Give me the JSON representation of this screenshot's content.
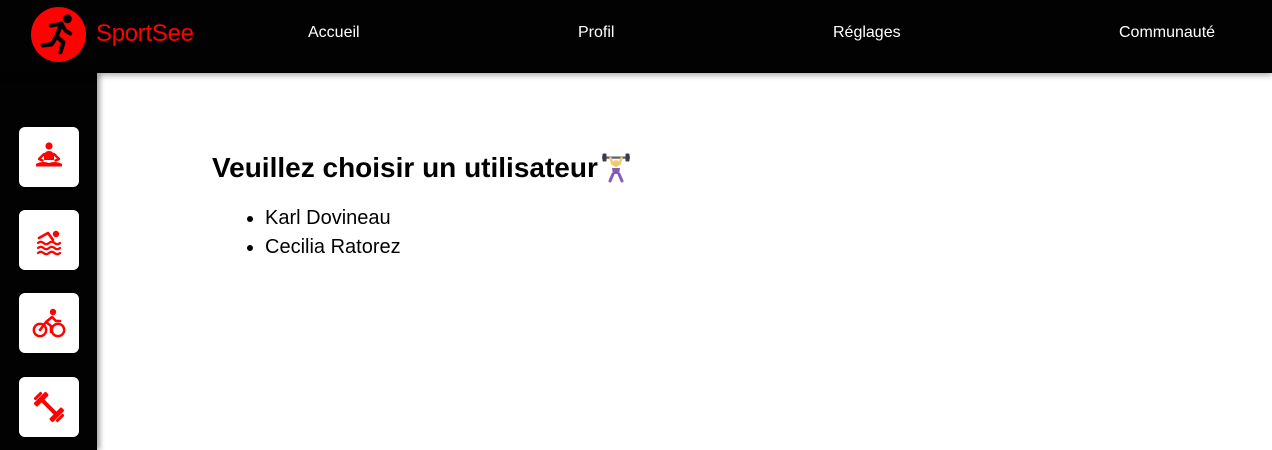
{
  "header": {
    "logo_text": "SportSee",
    "logo_icon": "runner-icon",
    "nav": [
      {
        "label": "Accueil"
      },
      {
        "label": "Profil"
      },
      {
        "label": "Réglages"
      },
      {
        "label": "Communauté"
      }
    ]
  },
  "sidebar": {
    "items": [
      {
        "icon": "meditation-icon"
      },
      {
        "icon": "swimming-icon"
      },
      {
        "icon": "cycling-icon"
      },
      {
        "icon": "dumbbell-icon"
      }
    ]
  },
  "main": {
    "title": "Veuillez choisir un utilisateur",
    "title_icon": "weightlifter-emoji",
    "users": [
      {
        "name": "Karl Dovineau"
      },
      {
        "name": "Cecilia Ratorez"
      }
    ]
  },
  "colors": {
    "brand": "#ff0101",
    "dark": "#020203",
    "background": "#ffffff"
  }
}
